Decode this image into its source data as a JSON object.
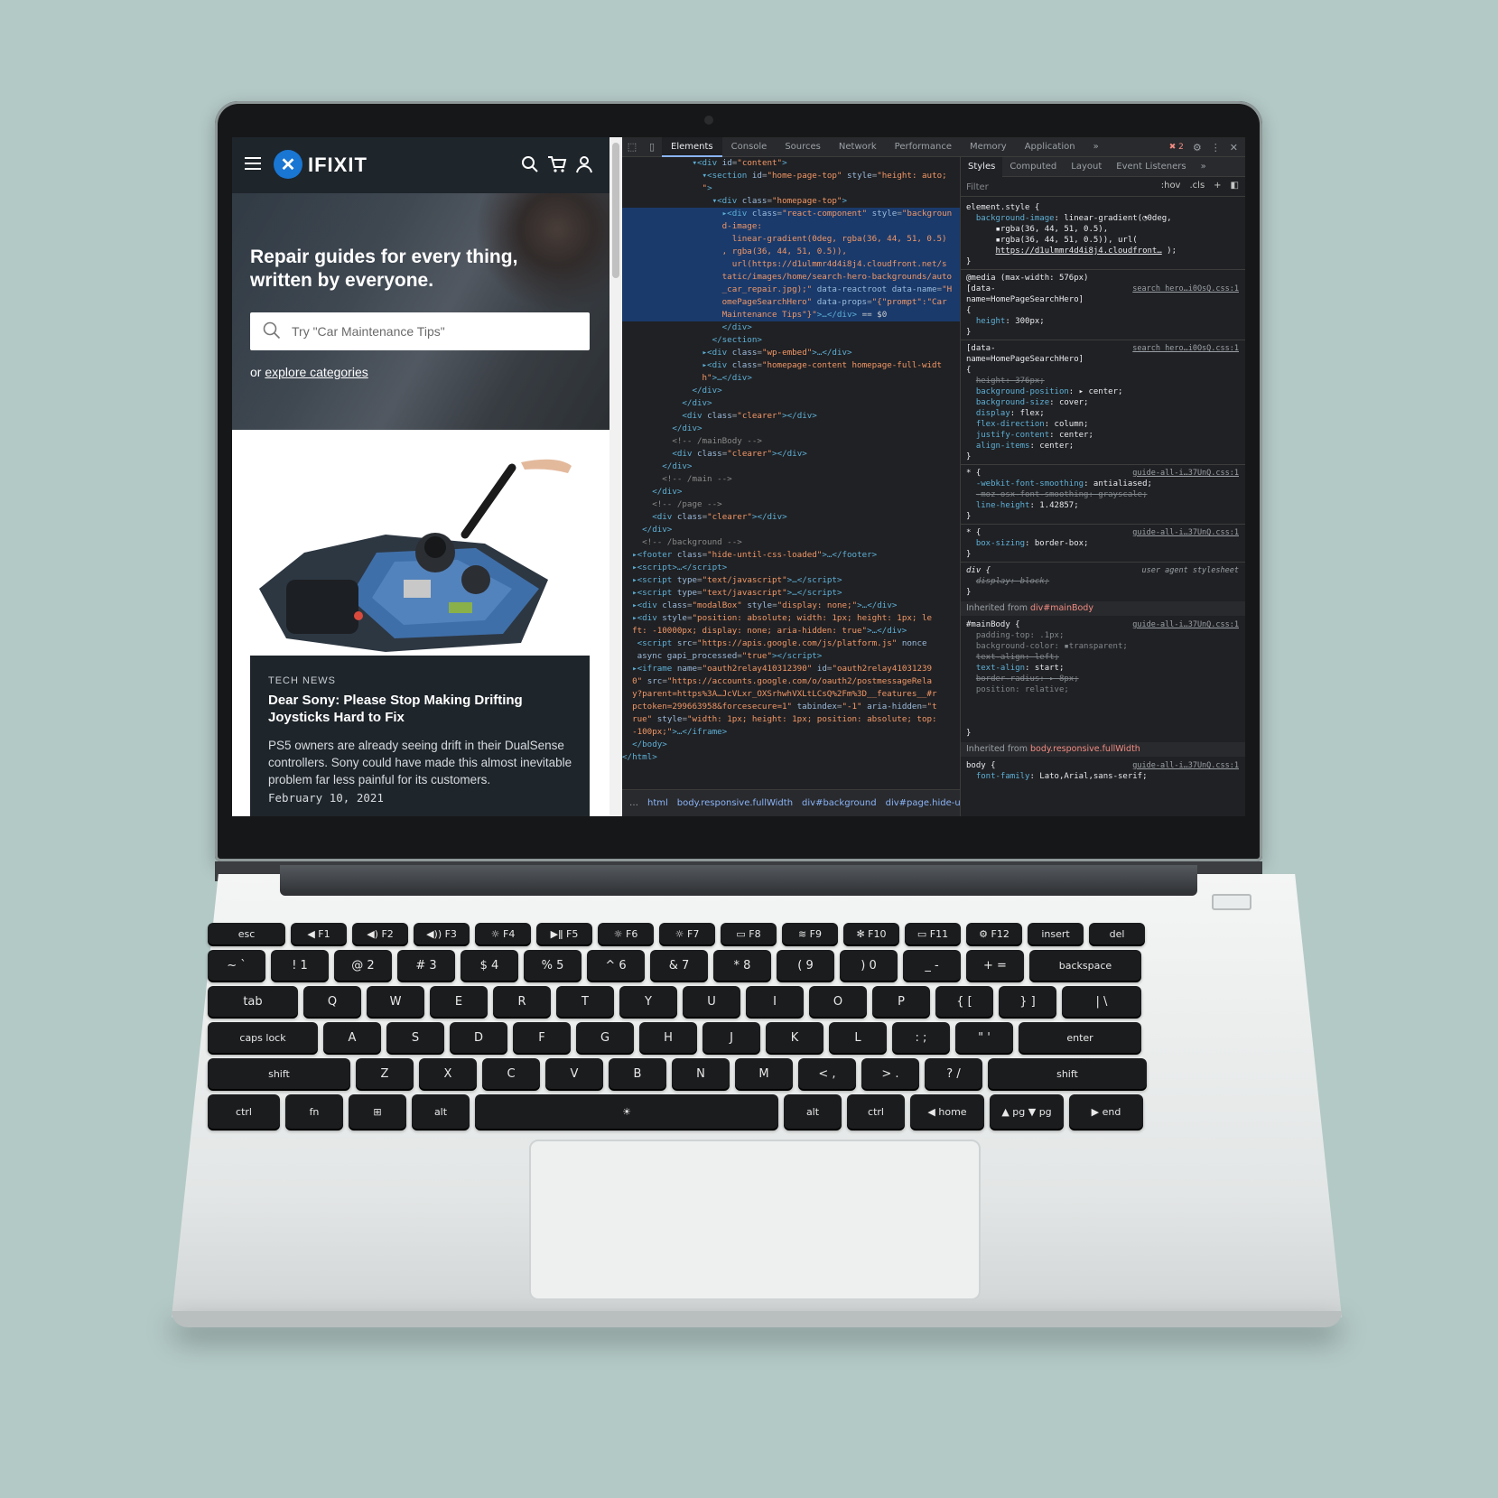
{
  "site": {
    "logo_mark": "✕",
    "logo_text": "IFIXIT",
    "hero_title": "Repair guides for every thing, written by everyone.",
    "search_placeholder": "Try \"Car Maintenance Tips\"",
    "explore_prefix": "or ",
    "explore_link": "explore categories",
    "card": {
      "kicker": "TECH NEWS",
      "title": "Dear Sony: Please Stop Making Drifting Joysticks Hard to Fix",
      "body": "PS5 owners are already seeing drift in their DualSense controllers. Sony could have made this almost inevitable problem far less painful for its customers.",
      "date": "February 10, 2021"
    }
  },
  "devtools": {
    "tabs": [
      "Elements",
      "Console",
      "Sources",
      "Network",
      "Performance",
      "Memory",
      "Application"
    ],
    "more_tabs": "»",
    "error_count": "2",
    "styles_tabs": [
      "Styles",
      "Computed",
      "Layout",
      "Event Listeners"
    ],
    "filter_placeholder": "Filter",
    "filter_hov": ":hov",
    "filter_cls": ".cls",
    "filter_plus": "+",
    "breadcrumb": [
      "html",
      "body.responsive.fullWidth",
      "div#background",
      "div#page.hide-un"
    ],
    "inherited_main_label": "Inherited from ",
    "inherited_main_target": "div#mainBody",
    "inherited_body_label": "Inherited from ",
    "inherited_body_target": "body.responsive.fullWidth"
  },
  "keyboard": {
    "row_fn": [
      "esc",
      "◀ F1",
      "◀) F2",
      "◀)) F3",
      "☼ F4",
      "▶ǁ F5",
      "☼ F6",
      "☼ F7",
      "▭ F8",
      "≋ F9",
      "✻ F10",
      "▭ F11",
      "⚙ F12",
      "insert",
      "del"
    ],
    "row_num": [
      "~ `",
      "! 1",
      "@ 2",
      "# 3",
      "$ 4",
      "% 5",
      "^ 6",
      "& 7",
      "* 8",
      "( 9",
      ") 0",
      "_ -",
      "+ =",
      "backspace"
    ],
    "row_q": [
      "tab",
      "Q",
      "W",
      "E",
      "R",
      "T",
      "Y",
      "U",
      "I",
      "O",
      "P",
      "{ [",
      "} ]",
      "| \\"
    ],
    "row_a": [
      "caps lock",
      "A",
      "S",
      "D",
      "F",
      "G",
      "H",
      "J",
      "K",
      "L",
      ": ;",
      "\" '",
      "enter"
    ],
    "row_z": [
      "shift",
      "Z",
      "X",
      "C",
      "V",
      "B",
      "N",
      "M",
      "< ,",
      "> .",
      "? /",
      "shift"
    ],
    "row_ctrl": [
      "ctrl",
      "fn",
      "⊞",
      "alt",
      "☀",
      "alt",
      "ctrl",
      "◀ home",
      "▲ pg ▼ pg",
      "▶ end"
    ]
  }
}
